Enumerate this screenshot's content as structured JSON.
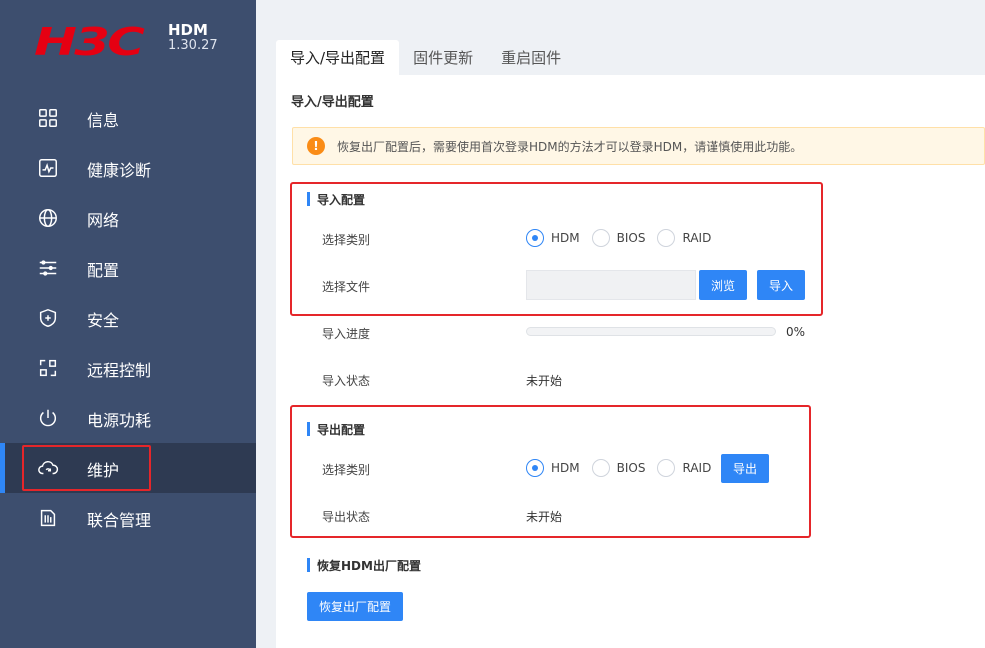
{
  "brand": {
    "logo": "H3C",
    "product": "HDM",
    "version": "1.30.27"
  },
  "sidebar": {
    "items": [
      {
        "label": "信息",
        "icon": "grid-icon"
      },
      {
        "label": "健康诊断",
        "icon": "pulse-icon"
      },
      {
        "label": "网络",
        "icon": "globe-icon"
      },
      {
        "label": "配置",
        "icon": "sliders-icon"
      },
      {
        "label": "安全",
        "icon": "shield-plus-icon"
      },
      {
        "label": "远程控制",
        "icon": "remote-icon"
      },
      {
        "label": "电源功耗",
        "icon": "power-icon"
      },
      {
        "label": "维护",
        "icon": "cloud-sync-icon",
        "active": true
      },
      {
        "label": "联合管理",
        "icon": "server-doc-icon"
      }
    ]
  },
  "tabs": [
    {
      "label": "导入/导出配置",
      "active": true
    },
    {
      "label": "固件更新"
    },
    {
      "label": "重启固件"
    }
  ],
  "panel": {
    "title": "导入/导出配置",
    "warning": "恢复出厂配置后，需要使用首次登录HDM的方法才可以登录HDM，请谨慎使用此功能。",
    "import": {
      "title": "导入配置",
      "type_label": "选择类别",
      "options": [
        "HDM",
        "BIOS",
        "RAID"
      ],
      "selected": "HDM",
      "file_label": "选择文件",
      "file_value": "",
      "browse_btn": "浏览",
      "import_btn": "导入",
      "progress_label": "导入进度",
      "progress_value": 0,
      "progress_text": "0%",
      "status_label": "导入状态",
      "status_value": "未开始"
    },
    "export": {
      "title": "导出配置",
      "type_label": "选择类别",
      "options": [
        "HDM",
        "BIOS",
        "RAID"
      ],
      "selected": "HDM",
      "export_btn": "导出",
      "status_label": "导出状态",
      "status_value": "未开始"
    },
    "restore": {
      "title": "恢复HDM出厂配置",
      "button": "恢复出厂配置"
    }
  },
  "colors": {
    "sidebar_bg": "#3d4e6e",
    "active_bg": "#2e3a52",
    "accent": "#2f86f6",
    "brand_red": "#e50012",
    "highlight_red": "#e5262a",
    "warn": "#fa8c16"
  }
}
